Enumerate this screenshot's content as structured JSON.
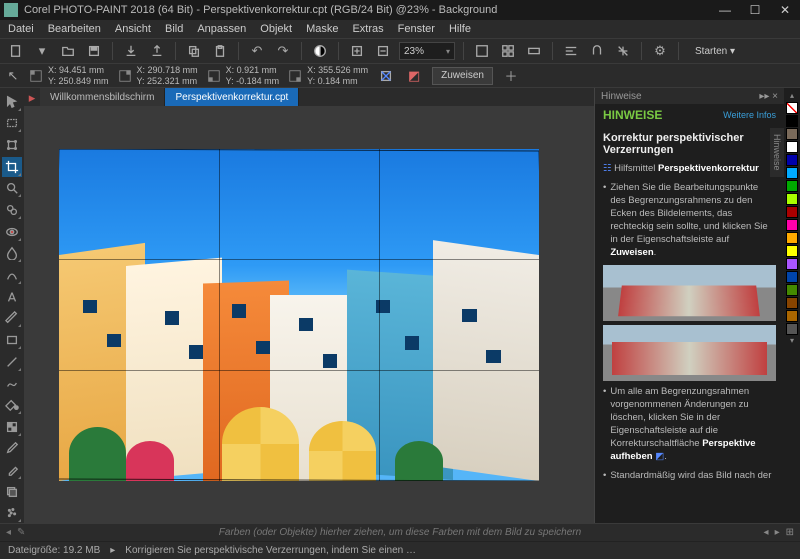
{
  "window": {
    "title": "Corel PHOTO-PAINT 2018 (64 Bit) - Perspektivenkorrektur.cpt (RGB/24 Bit) @23% - Background"
  },
  "menu": [
    "Datei",
    "Bearbeiten",
    "Ansicht",
    "Bild",
    "Anpassen",
    "Objekt",
    "Maske",
    "Extras",
    "Fenster",
    "Hilfe"
  ],
  "toolbar": {
    "zoom": "23%",
    "launch_label": "Starten"
  },
  "prop": {
    "c1": {
      "x": "X: 94.451 mm",
      "y": "Y: 250.849 mm"
    },
    "c2": {
      "x": "X: 290.718 mm",
      "y": "Y: 252.321 mm"
    },
    "c3": {
      "x": "X: 0.921 mm",
      "y": "Y: -0.184 mm"
    },
    "c4": {
      "x": "X: 355.526 mm",
      "y": "Y: 0.184 mm"
    },
    "assign": "Zuweisen"
  },
  "tabs": [
    {
      "label": "Willkommensbildschirm",
      "active": false
    },
    {
      "label": "Perspektivenkorrektur.cpt",
      "active": true
    }
  ],
  "hints": {
    "panel": "Hinweise",
    "title": "HINWEISE",
    "link": "Weitere Infos",
    "subtitle": "Korrektur perspektivischer Verzerrungen",
    "tool_label": "Hilfsmittel ",
    "tool_name": "Perspektivenkorrektur",
    "para1": "Ziehen Sie die Bearbeitungspunkte des Begrenzungsrahmens zu den Ecken des Bildelements, das rechteckig sein sollte, und klicken Sie in der Eigenschaftsleiste auf ",
    "para1b": "Zuweisen",
    "para2": "Um alle am Begrenzungsrahmen vorgenommenen Änderungen zu löschen, klicken Sie in der Eigenschaftsleiste auf die Korrekturschaltfläche ",
    "para2b": "Perspektive aufheben",
    "para3": "Standardmäßig wird das Bild nach der",
    "vert": "Hinweise"
  },
  "palette_colors": [
    "#000000",
    "#808080",
    "#ffffff",
    "#ff0000",
    "#ff8000",
    "#ffff00",
    "#00ff00",
    "#00ffff",
    "#0080ff",
    "#0000ff",
    "#8000ff",
    "#ff00ff",
    "#800000",
    "#400000",
    "#804000",
    "#004000"
  ],
  "footer": {
    "hint": "Farben (oder Objekte) hierher ziehen, um diese Farben mit dem Bild zu speichern"
  },
  "status": {
    "size": "Dateigröße: 19.2 MB",
    "tip": "Korrigieren Sie perspektivische Verzerrungen, indem Sie einen …"
  }
}
